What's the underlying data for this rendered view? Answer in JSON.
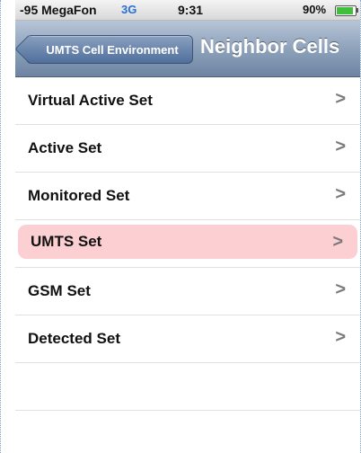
{
  "status_bar": {
    "carrier": "-95 MegaFon",
    "network": "3G",
    "time": "9:31",
    "battery_percent": "90%",
    "battery_level": 0.9,
    "network_color": "#2a6fd6",
    "battery_color": "#3ec03a"
  },
  "nav": {
    "back_label": "UMTS Cell Environment",
    "title": "Neighbor Cells"
  },
  "list": {
    "items": [
      {
        "label": "Virtual Active Set",
        "chevron": ">"
      },
      {
        "label": "Active Set",
        "chevron": ">"
      },
      {
        "label": "Monitored Set",
        "chevron": ">"
      },
      {
        "label": "UMTS Set",
        "chevron": ">",
        "highlighted": true,
        "highlight_color": "#fccfd2"
      },
      {
        "label": "GSM Set",
        "chevron": ">"
      },
      {
        "label": "Detected Set",
        "chevron": ">"
      }
    ]
  }
}
